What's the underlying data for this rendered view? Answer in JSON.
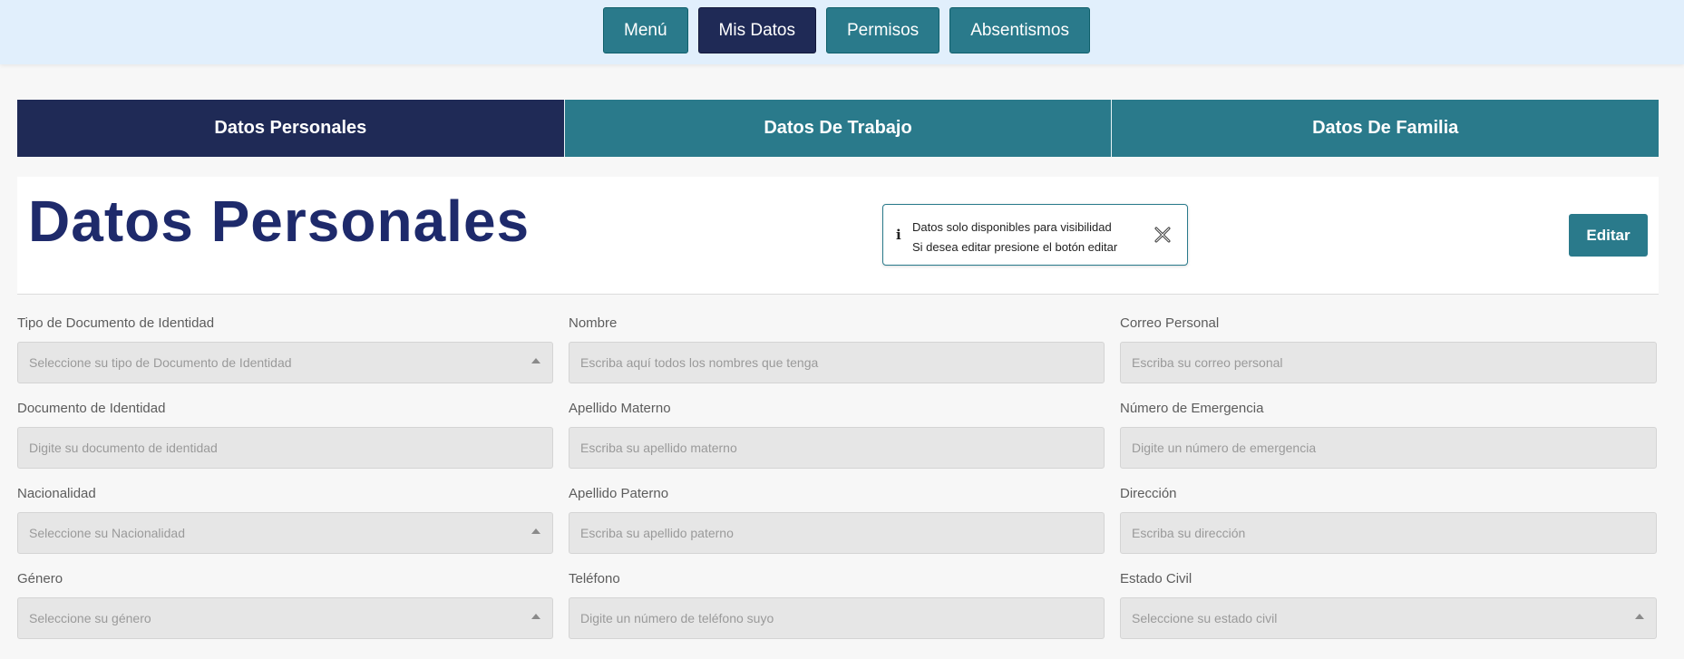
{
  "topnav": {
    "items": [
      {
        "label": "Menú",
        "active": false
      },
      {
        "label": "Mis Datos",
        "active": true
      },
      {
        "label": "Permisos",
        "active": false
      },
      {
        "label": "Absentismos",
        "active": false
      }
    ]
  },
  "tabs": {
    "items": [
      {
        "label": "Datos Personales",
        "active": true
      },
      {
        "label": "Datos De Trabajo",
        "active": false
      },
      {
        "label": "Datos De Familia",
        "active": false
      }
    ]
  },
  "header": {
    "title": "Datos Personales",
    "notice": {
      "icon": "info-icon",
      "line1": "Datos solo disponibles para visibilidad",
      "line2": "Si desea editar presione el botón editar"
    },
    "edit_label": "Editar"
  },
  "form": {
    "fields": [
      {
        "label": "Tipo de Documento de Identidad",
        "placeholder": "Seleccione su tipo de Documento de Identidad",
        "type": "select"
      },
      {
        "label": "Nombre",
        "placeholder": "Escriba aquí todos los nombres que tenga",
        "type": "text"
      },
      {
        "label": "Correo Personal",
        "placeholder": "Escriba su correo personal",
        "type": "text"
      },
      {
        "label": "Documento de Identidad",
        "placeholder": "Digite su documento de identidad",
        "type": "text"
      },
      {
        "label": "Apellido Materno",
        "placeholder": "Escriba su apellido materno",
        "type": "text"
      },
      {
        "label": "Número de Emergencia",
        "placeholder": "Digite un número de emergencia",
        "type": "text"
      },
      {
        "label": "Nacionalidad",
        "placeholder": "Seleccione su Nacionalidad",
        "type": "select"
      },
      {
        "label": "Apellido Paterno",
        "placeholder": "Escriba su apellido paterno",
        "type": "text"
      },
      {
        "label": "Dirección",
        "placeholder": "Escriba su dirección",
        "type": "text"
      },
      {
        "label": "Género",
        "placeholder": "Seleccione su género",
        "type": "select"
      },
      {
        "label": "Teléfono",
        "placeholder": "Digite un número de teléfono suyo",
        "type": "text"
      },
      {
        "label": "Estado Civil",
        "placeholder": "Seleccione su estado civil",
        "type": "select"
      }
    ]
  },
  "colors": {
    "accent": "#2a7a8b",
    "active": "#1f2a56",
    "title": "#1e2a6b",
    "topbar_bg": "#e1effc"
  }
}
